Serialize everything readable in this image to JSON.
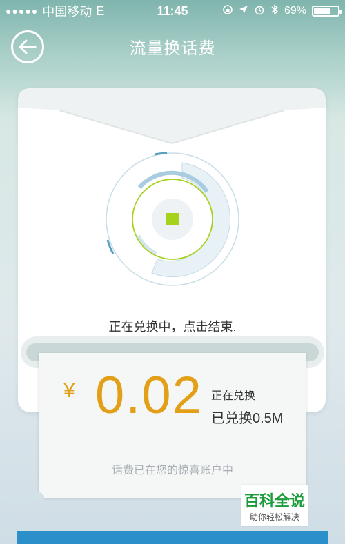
{
  "status_bar": {
    "carrier": "中国移动",
    "network": "E",
    "time": "11:45",
    "battery": "69%",
    "battery_level": 0.69
  },
  "nav": {
    "title": "流量换话费",
    "back_icon": "back-arrow-icon"
  },
  "exchange": {
    "status_text": "正在兑换中，点击结束.",
    "currency": "¥",
    "amount": "0.02",
    "status_label": "正在兑换",
    "exchanged_label": "已兑换0.5M",
    "footnote": "话费已在您的惊喜账户中"
  },
  "watermark": {
    "title": "百科全说",
    "subtitle": "助你轻松解决"
  },
  "colors": {
    "accent_orange": "#e2a018",
    "dial_green": "#a6d21e",
    "bottom_blue": "#2b8fc9",
    "watermark_green": "#1b9b3a"
  }
}
